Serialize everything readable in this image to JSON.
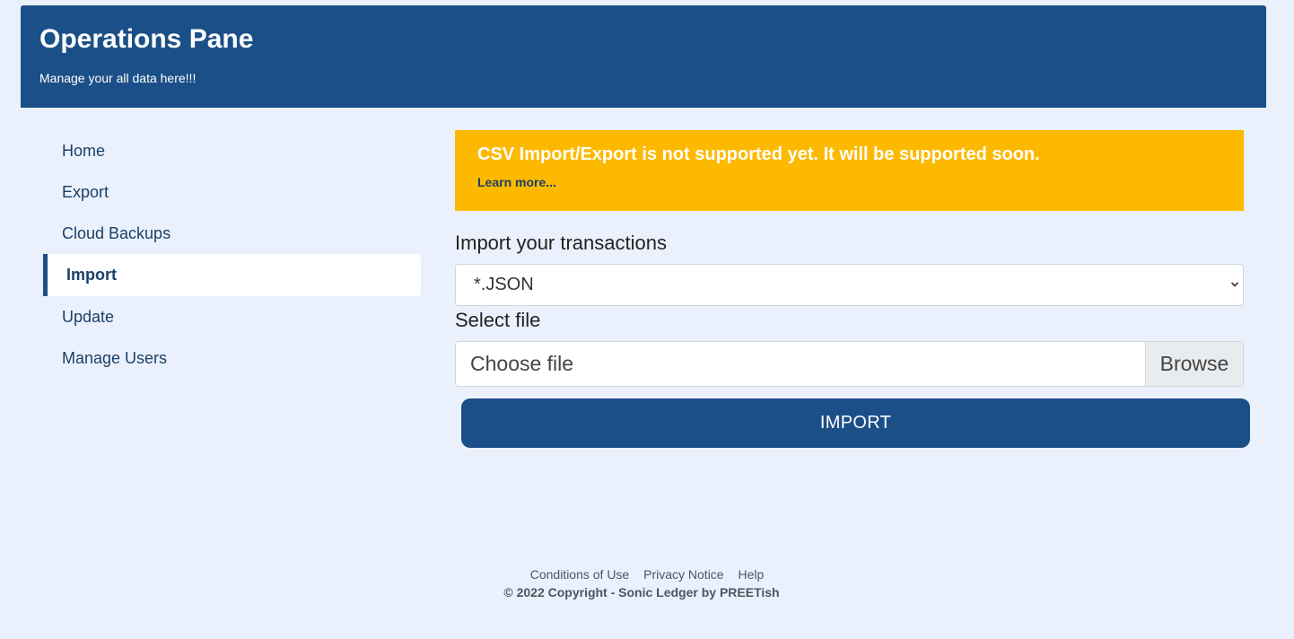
{
  "header": {
    "title": "Operations Pane",
    "subtitle": "Manage your all data here!!!"
  },
  "sidebar": {
    "items": [
      {
        "label": "Home"
      },
      {
        "label": "Export"
      },
      {
        "label": "Cloud Backups"
      },
      {
        "label": "Import",
        "active": true
      },
      {
        "label": "Update"
      },
      {
        "label": "Manage Users"
      }
    ]
  },
  "alert": {
    "message": "CSV Import/Export is not supported yet. It will be supported soon.",
    "link_text": "Learn more..."
  },
  "form": {
    "import_label": "Import your transactions",
    "format_selected": "*.JSON",
    "file_label": "Select file",
    "file_placeholder": "Choose file",
    "browse_label": "Browse",
    "import_button": "IMPORT"
  },
  "footer": {
    "links": [
      "Conditions of Use",
      "Privacy Notice",
      "Help"
    ],
    "copyright": "© 2022 Copyright - Sonic Ledger by PREETish"
  },
  "colors": {
    "header_bg": "#1b4f87",
    "page_bg": "#eaf1fd",
    "alert_bg": "#fdb900",
    "button_bg": "#1b4f87"
  },
  "icons": {
    "select_chevron": "chevron-down-icon"
  }
}
